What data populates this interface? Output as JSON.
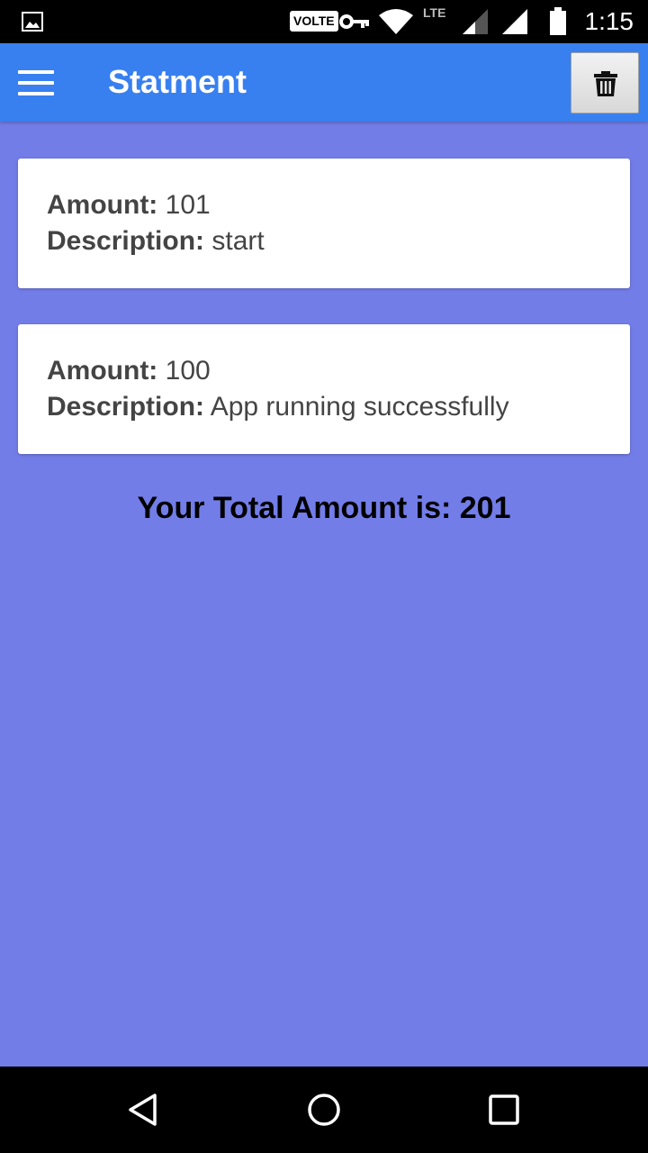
{
  "status_bar": {
    "volte": "VOLTE",
    "lte": "LTE",
    "time": "1:15",
    "icons": [
      "gallery-icon",
      "key-icon",
      "wifi-icon",
      "signal-icon",
      "battery-icon"
    ]
  },
  "app_bar": {
    "title": "Statment",
    "menu_icon": "hamburger-menu-icon",
    "delete_icon": "trash-icon",
    "color": "#3880f0"
  },
  "transactions": [
    {
      "amount_label": "Amount:",
      "amount": "101",
      "description_label": "Description:",
      "description": "start"
    },
    {
      "amount_label": "Amount:",
      "amount": "100",
      "description_label": "Description:",
      "description": "App running successfully"
    }
  ],
  "summary": {
    "total_text": "Your Total Amount is: 201"
  },
  "nav_bar": {
    "icons": [
      "back-icon",
      "home-icon",
      "recents-icon"
    ]
  },
  "colors": {
    "background": "#737de8",
    "card": "#ffffff"
  }
}
